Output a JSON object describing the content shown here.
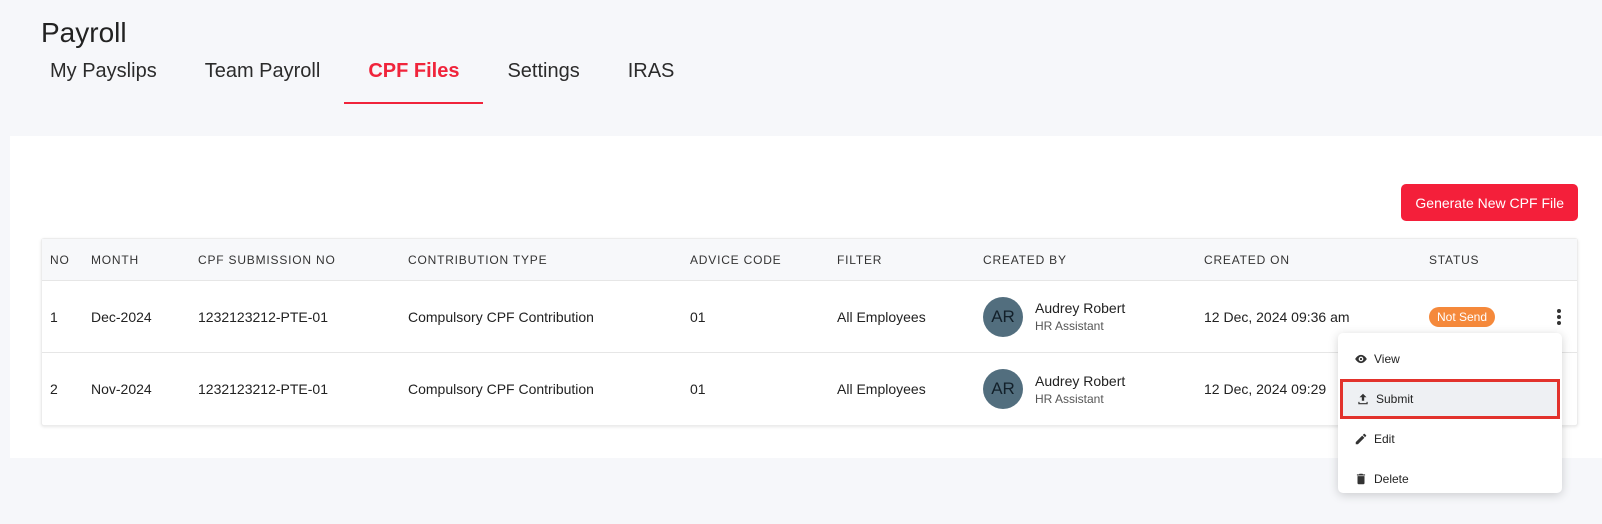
{
  "page": {
    "title": "Payroll"
  },
  "tabs": [
    {
      "label": "My Payslips"
    },
    {
      "label": "Team Payroll"
    },
    {
      "label": "CPF Files",
      "active": true
    },
    {
      "label": "Settings"
    },
    {
      "label": "IRAS"
    }
  ],
  "actions": {
    "generate_label": "Generate New CPF File"
  },
  "table": {
    "headers": {
      "no": "NO",
      "month": "MONTH",
      "submission": "CPF SUBMISSION NO",
      "contribution": "CONTRIBUTION TYPE",
      "advice": "ADVICE CODE",
      "filter": "FILTER",
      "created_by": "CREATED BY",
      "created_on": "CREATED ON",
      "status": "STATUS"
    },
    "rows": [
      {
        "no": "1",
        "month": "Dec-2024",
        "submission": "1232123212-PTE-01",
        "contribution": "Compulsory CPF Contribution",
        "advice": "01",
        "filter": "All Employees",
        "avatar_initials": "AR",
        "created_by_name": "Audrey Robert",
        "created_by_role": "HR Assistant",
        "created_on": "12 Dec, 2024 09:36 am",
        "status": "Not Send"
      },
      {
        "no": "2",
        "month": "Nov-2024",
        "submission": "1232123212-PTE-01",
        "contribution": "Compulsory CPF Contribution",
        "advice": "01",
        "filter": "All Employees",
        "avatar_initials": "AR",
        "created_by_name": "Audrey Robert",
        "created_by_role": "HR Assistant",
        "created_on": "12 Dec, 2024 09:29"
      }
    ]
  },
  "context_menu": {
    "items": [
      {
        "label": "View",
        "icon": "eye-icon"
      },
      {
        "label": "Submit",
        "icon": "upload-icon",
        "highlighted": true
      },
      {
        "label": "Edit",
        "icon": "pencil-icon"
      },
      {
        "label": "Delete",
        "icon": "trash-icon"
      }
    ]
  },
  "colors": {
    "accent": "#f0243b",
    "button": "#f41f3a",
    "status_not_send": "#f5893b",
    "avatar": "#526e7e",
    "highlight_outline": "#e2322c"
  }
}
